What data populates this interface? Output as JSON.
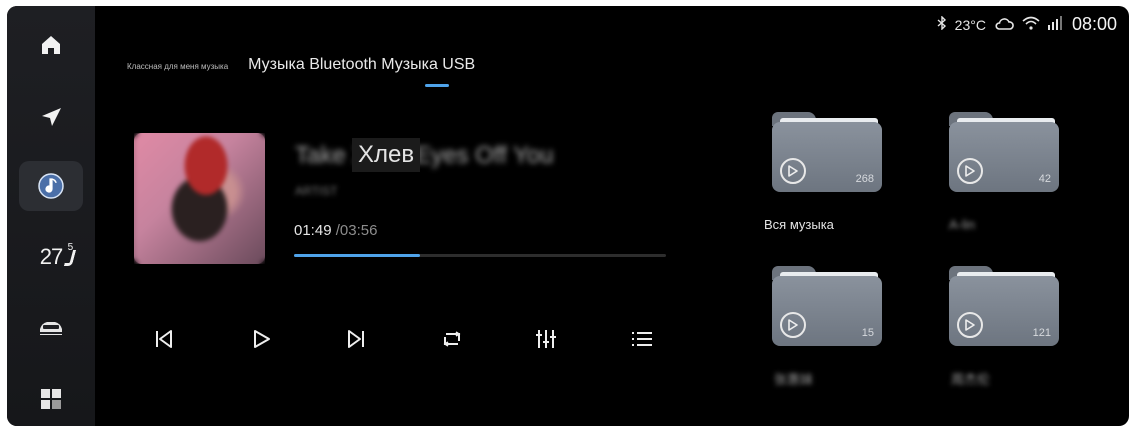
{
  "status": {
    "temperature": "23°C",
    "time": "08:00",
    "icons": [
      "bluetooth-icon",
      "cloud-icon",
      "wifi-icon",
      "signal-icon"
    ]
  },
  "dock": {
    "items": [
      {
        "icon": "home-icon"
      },
      {
        "icon": "navigation-icon"
      },
      {
        "icon": "music-icon",
        "active": true
      },
      {
        "icon": "seat-temperature-icon",
        "label": "27",
        "sup": "5"
      },
      {
        "icon": "car-icon"
      },
      {
        "icon": "apps-grid-icon"
      }
    ]
  },
  "tabs": {
    "small": "Классная для меня музыка",
    "main": "Музыка Bluetooth Музыка USB"
  },
  "now_playing": {
    "title_blurred": "Take Хлев Eyes Off You",
    "title_visible": "Хлев",
    "artist_blurred": "ARTIST",
    "elapsed": "01:49",
    "separator": " /",
    "duration": "03:56",
    "progress": 0.34
  },
  "controls": [
    "prev-icon",
    "play-icon",
    "next-icon",
    "repeat-icon",
    "equalizer-icon",
    "playlist-icon"
  ],
  "folders": [
    {
      "label": "Вся музыка",
      "count": "268",
      "blurred": false
    },
    {
      "label": "A-lin",
      "count": "42",
      "blurred": true
    },
    {
      "label": "张惠妹",
      "count": "15",
      "blurred": true
    },
    {
      "label": "周杰伦",
      "count": "121",
      "blurred": true
    }
  ],
  "colors": {
    "accent": "#4fa3ea",
    "background": "#000000",
    "dock": "#1e1f23"
  }
}
